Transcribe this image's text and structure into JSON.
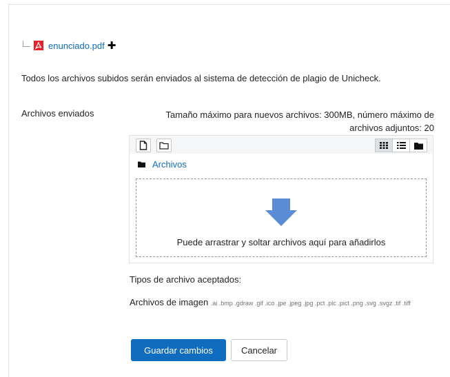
{
  "submission": {
    "file_name": "enunciado.pdf",
    "file_icon": "pdf-icon",
    "add_icon": "plus-icon"
  },
  "plagiarism_notice": "Todos los archivos subidos serán enviados al sistema de detección de plagio de Unicheck.",
  "field": {
    "label": "Archivos enviados",
    "limits_line1": "Tamaño máximo para nuevos archivos: 300MB, número máximo de",
    "limits_line2": "archivos adjuntos: 20"
  },
  "filepicker": {
    "toolbar": {
      "add_file_icon": "file-icon",
      "create_folder_icon": "folder-outline-icon",
      "views": [
        "grid-view-icon",
        "list-view-icon",
        "tree-view-icon"
      ],
      "active_view": "grid-view-icon"
    },
    "path_label": "Archivos",
    "drop_text": "Puede arrastrar y soltar archivos aquí para añadirlos",
    "arrow_color": "#5b8dd6"
  },
  "accepted_types": {
    "heading": "Tipos de archivo aceptados:",
    "group_name": "Archivos de imagen",
    "extensions": ".ai .bmp .gdraw .gif .ico .jpe .jpeg .jpg .pct .pic .pict .png .svg .svgz .tif .tiff"
  },
  "actions": {
    "save_label": "Guardar cambios",
    "cancel_label": "Cancelar"
  },
  "colors": {
    "primary": "#0f6cbf",
    "link": "#0f6cbf"
  }
}
